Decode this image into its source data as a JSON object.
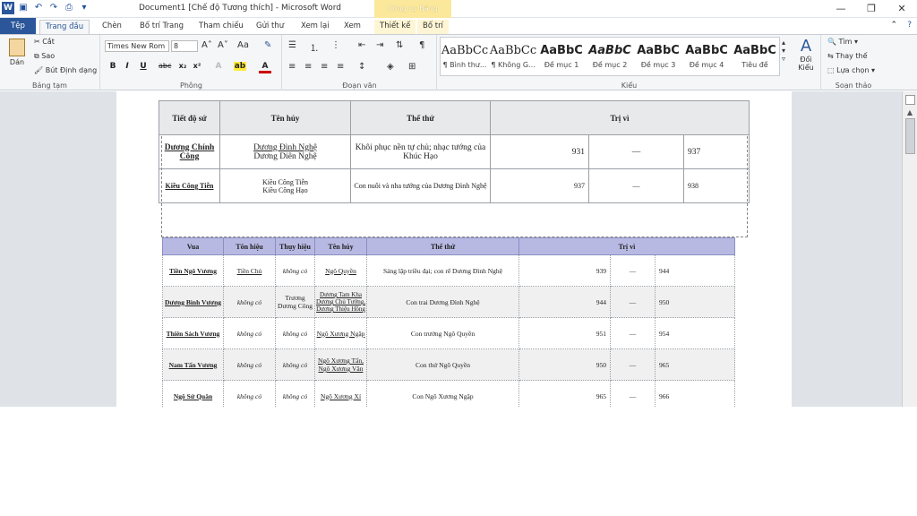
{
  "title_bar": {
    "doc_title": "Document1 [Chế độ Tương thích] - Microsoft Word",
    "context_tab_group": "Công cụ Bảng"
  },
  "tabs": [
    "Tệp",
    "Trang đầu",
    "Chèn",
    "Bố trí Trang",
    "Tham chiếu",
    "Gửi thư",
    "Xem lại",
    "Xem",
    "Thiết kế",
    "Bố trí"
  ],
  "ribbon": {
    "clipboard": {
      "paste": "Dán",
      "cut": "Cắt",
      "copy": "Sao",
      "format_painter": "Bút Định dạng",
      "label": "Bảng tạm"
    },
    "font": {
      "name": "Times New Rom",
      "size": "8",
      "label": "Phông"
    },
    "paragraph": {
      "label": "Đoạn văn"
    },
    "styles": {
      "items": [
        {
          "preview": "AaBbCc",
          "name": "¶ Bình thư..."
        },
        {
          "preview": "AaBbCc",
          "name": "¶ Không G..."
        },
        {
          "preview": "AaBbC",
          "name": "Đề mục 1"
        },
        {
          "preview": "AaBbC",
          "name": "Đề mục 2"
        },
        {
          "preview": "AaBbC",
          "name": "Đề mục 3"
        },
        {
          "preview": "AaBbC",
          "name": "Đề mục 4"
        },
        {
          "preview": "AaBbC",
          "name": "Tiêu đề"
        }
      ],
      "change": "Đổi Kiểu",
      "label": "Kiểu"
    },
    "editing": {
      "find": "Tìm",
      "replace": "Thay thế",
      "select": "Lựa chọn",
      "label": "Soạn thảo"
    }
  },
  "table1": {
    "headers": [
      "Tiết độ sứ",
      "Tên húy",
      "Thế thứ",
      "Trị vì"
    ],
    "rows": [
      {
        "c1": "Dương Chính Công",
        "c2a": "Dương Đình Nghệ",
        "c2b": "Dương Diên Nghệ",
        "c3": "Khôi phục nền tự chủ; nhạc tướng của Khúc Hạo",
        "y1": "931",
        "dash": "—",
        "y2": "937"
      },
      {
        "c1": "Kiều Công Tiễn",
        "c2a": "Kiều Công Tiễn",
        "c2b": "Kiều Công Hạo",
        "c3": "Con nuôi và nha tướng của Dương Đình Nghệ",
        "y1": "937",
        "dash": "—",
        "y2": "938"
      }
    ]
  },
  "table2": {
    "headers": [
      "Vua",
      "Tôn hiệu",
      "Thụy hiệu",
      "Tên húy",
      "Thế thứ",
      "Trị vì"
    ],
    "rows": [
      {
        "vua": "Tiền Ngô Vương",
        "ton": "Tiền Chủ",
        "thuy": "không có",
        "huy": "Ngô Quyền",
        "the": "Sáng lập triều đại; con rể Dương Đình Nghệ",
        "y1": "939",
        "dash": "—",
        "y2": "944"
      },
      {
        "vua": "Dương Bình Vương",
        "ton": "không có",
        "thuy": "Trương Dương Công",
        "huy": "Dương Tam Kha Dương Chủ Tướng, Dương Thiệu Hồng",
        "the": "Con trai Dương Đình Nghệ",
        "y1": "944",
        "dash": "—",
        "y2": "950"
      },
      {
        "vua": "Thiên Sách Vương",
        "ton": "không có",
        "thuy": "không có",
        "huy": "Ngô Xương Ngập",
        "the": "Con trưởng Ngô Quyền",
        "y1": "951",
        "dash": "—",
        "y2": "954"
      },
      {
        "vua": "Nam Tấn Vương",
        "ton": "không có",
        "thuy": "không có",
        "huy": "Ngô Xương Tấn, Ngô Xương Văn",
        "the": "Con thứ Ngô Quyền",
        "y1": "950",
        "dash": "—",
        "y2": "965"
      },
      {
        "vua": "Ngô Sứ Quân",
        "ton": "không có",
        "thuy": "không có",
        "huy": "Ngô Xương Xí",
        "the": "Con Ngô Xương Ngập",
        "y1": "965",
        "dash": "—",
        "y2": "966"
      }
    ]
  }
}
